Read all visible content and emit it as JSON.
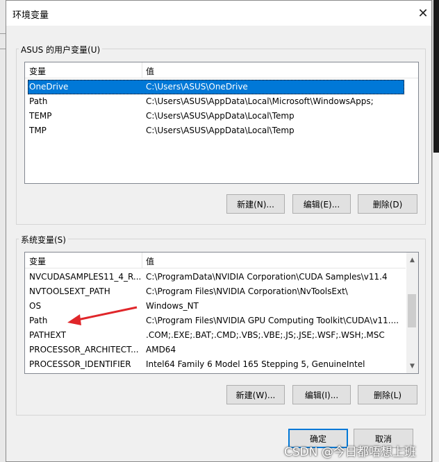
{
  "dialog": {
    "title": "环境变量",
    "close_icon": "close-icon"
  },
  "user_vars": {
    "group_label": "ASUS 的用户变量(U)",
    "col_var": "变量",
    "col_val": "值",
    "rows": [
      {
        "name": "OneDrive",
        "value": "C:\\Users\\ASUS\\OneDrive",
        "selected": true
      },
      {
        "name": "Path",
        "value": "C:\\Users\\ASUS\\AppData\\Local\\Microsoft\\WindowsApps;"
      },
      {
        "name": "TEMP",
        "value": "C:\\Users\\ASUS\\AppData\\Local\\Temp"
      },
      {
        "name": "TMP",
        "value": "C:\\Users\\ASUS\\AppData\\Local\\Temp"
      }
    ],
    "btn_new": "新建(N)...",
    "btn_edit": "编辑(E)...",
    "btn_delete": "删除(D)"
  },
  "system_vars": {
    "group_label": "系统变量(S)",
    "col_var": "变量",
    "col_val": "值",
    "rows": [
      {
        "name": "NVCUDASAMPLES11_4_R...",
        "value": "C:\\ProgramData\\NVIDIA Corporation\\CUDA Samples\\v11.4"
      },
      {
        "name": "NVTOOLSEXT_PATH",
        "value": "C:\\Program Files\\NVIDIA Corporation\\NvToolsExt\\"
      },
      {
        "name": "OS",
        "value": "Windows_NT"
      },
      {
        "name": "Path",
        "value": "C:\\Program Files\\NVIDIA GPU Computing Toolkit\\CUDA\\v11...."
      },
      {
        "name": "PATHEXT",
        "value": ".COM;.EXE;.BAT;.CMD;.VBS;.VBE;.JS;.JSE;.WSF;.WSH;.MSC"
      },
      {
        "name": "PROCESSOR_ARCHITECT...",
        "value": "AMD64"
      },
      {
        "name": "PROCESSOR_IDENTIFIER",
        "value": "Intel64 Family 6 Model 165 Stepping 5, GenuineIntel"
      }
    ],
    "btn_new": "新建(W)...",
    "btn_edit": "编辑(I)...",
    "btn_delete": "删除(L)"
  },
  "footer": {
    "ok": "确定",
    "cancel": "取消"
  },
  "watermark": "CSDN @今日都唔想上班",
  "colors": {
    "selection": "#0078d7",
    "arrow": "#e0262a"
  }
}
